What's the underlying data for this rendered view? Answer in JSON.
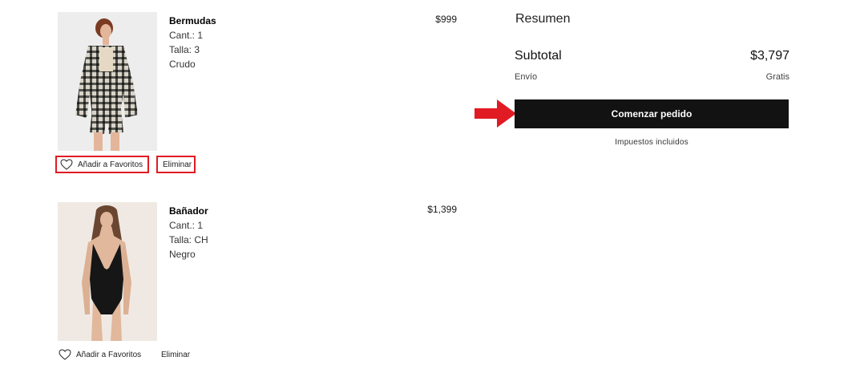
{
  "cart": {
    "items": [
      {
        "name": "Bermudas",
        "quantity": "Cant.: 1",
        "size": "Talla: 3",
        "color": "Crudo",
        "price": "$999",
        "favorite_label": "Añadir a Favoritos",
        "remove_label": "Eliminar",
        "highlighted_actions": true
      },
      {
        "name": "Bañador",
        "quantity": "Cant.: 1",
        "size": "Talla: CH",
        "color": "Negro",
        "price": "$1,399",
        "favorite_label": "Añadir a Favoritos",
        "remove_label": "Eliminar",
        "highlighted_actions": false
      }
    ]
  },
  "summary": {
    "title": "Resumen",
    "subtotal_label": "Subtotal",
    "subtotal_value": "$3,797",
    "shipping_label": "Envío",
    "shipping_value": "Gratis",
    "checkout_label": "Comenzar pedido",
    "tax_note": "Impuestos incluidos"
  },
  "colors": {
    "highlight": "#e01b24",
    "button_bg": "#121212",
    "button_text": "#ffffff"
  },
  "icons": {
    "favorite": "heart-outline-icon",
    "pointer": "red-arrow-right-icon"
  }
}
